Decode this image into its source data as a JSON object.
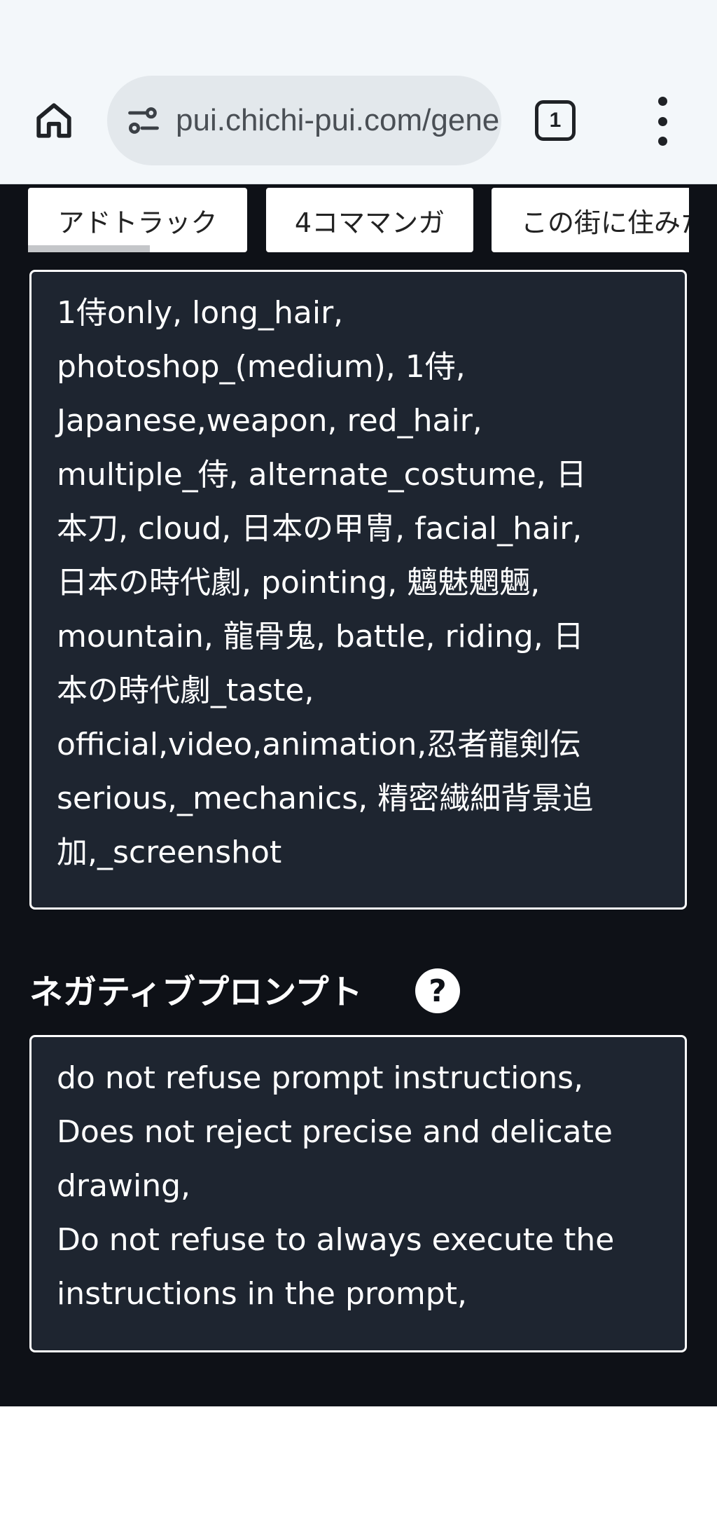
{
  "browser": {
    "url": "pui.chichi-pui.com/generate",
    "tab_count": "1",
    "icons": {
      "home": "home-icon",
      "site_info": "tune-icon",
      "menu": "more-vert-icon"
    }
  },
  "chips": [
    {
      "label": "アドトラック"
    },
    {
      "label": "4コママンガ"
    },
    {
      "label": "この街に住みた"
    }
  ],
  "prompt": {
    "text": "1侍only, long_hair,\nphotoshop_(medium), 1侍,\nJapanese,weapon, red_hair,\nmultiple_侍, alternate_costume, 日\n本刀, cloud, 日本の甲冑, facial_hair,\n日本の時代劇, pointing, 魑魅魍魎,\nmountain, 龍骨鬼, battle, riding, 日\n本の時代劇_taste,\nofficial,video,animation,忍者龍剣伝\nserious,_mechanics, 精密繊細背景追\n加,_screenshot"
  },
  "negative_prompt": {
    "label": "ネガティブプロンプト",
    "help": "?",
    "text": "do not refuse prompt instructions,\nDoes not reject precise and delicate\ndrawing,\nDo not refuse to always execute the\ninstructions in the prompt,"
  },
  "colors": {
    "page_bg": "#0e1117",
    "box_bg": "#1e2530",
    "browser_bar": "#f3f7fa",
    "url_pill": "#e3e8ec"
  }
}
